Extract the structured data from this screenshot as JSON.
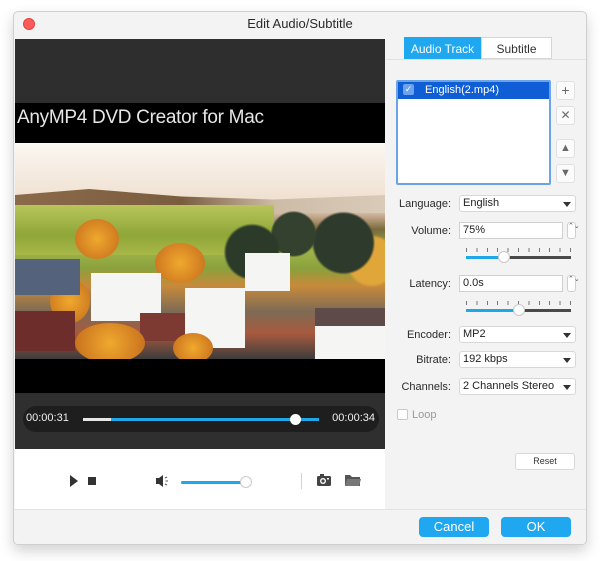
{
  "window": {
    "title": "Edit Audio/Subtitle"
  },
  "preview": {
    "watermark": "AnyMP4 DVD Creator for Mac",
    "current_time": "00:00:31",
    "end_time": "00:00:34",
    "seek_progress": 0.9,
    "volume_level": 0.95
  },
  "tabs": [
    {
      "label": "Audio Track",
      "active": true
    },
    {
      "label": "Subtitle",
      "active": false
    }
  ],
  "tracks": [
    {
      "label": "English(2.mp4)",
      "checked": true,
      "check_glyph": "✓"
    }
  ],
  "side_buttons": {
    "add": "+",
    "remove": "✕",
    "up": "▲",
    "down": "▼"
  },
  "settings": {
    "language_label": "Language:",
    "language_value": "English",
    "volume_label": "Volume:",
    "volume_value": "75%",
    "volume_slider": 0.36,
    "latency_label": "Latency:",
    "latency_value": "0.0s",
    "latency_slider": 0.5,
    "encoder_label": "Encoder:",
    "encoder_value": "MP2",
    "bitrate_label": "Bitrate:",
    "bitrate_value": "192 kbps",
    "channels_label": "Channels:",
    "channels_value": "2 Channels Stereo",
    "loop_label": "Loop",
    "loop_checked": false,
    "stepper_glyph": "⌃⌄"
  },
  "buttons": {
    "reset": "Reset",
    "cancel": "Cancel",
    "ok": "OK"
  },
  "colors": {
    "accent": "#1fa7f0",
    "selection": "#0f5ed6",
    "close": "#fc5b57"
  }
}
